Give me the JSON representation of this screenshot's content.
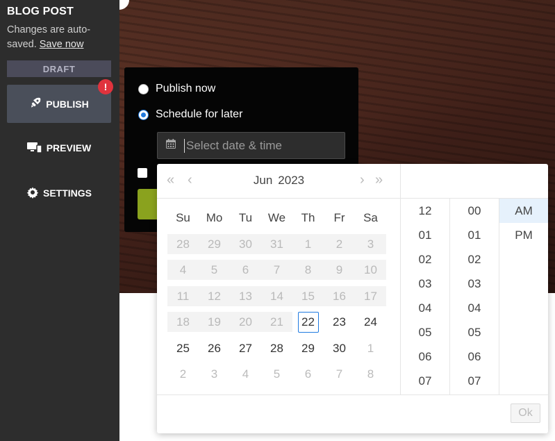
{
  "sidebar": {
    "title": "BLOG POST",
    "note": "Changes are auto-saved.",
    "save_link": "Save now",
    "status": "DRAFT",
    "alert": "!",
    "publish": "PUBLISH",
    "preview": "PREVIEW",
    "settings": "SETTINGS"
  },
  "popover": {
    "publish_now": "Publish now",
    "schedule_later": "Schedule for later",
    "date_placeholder": "Select date & time",
    "selected_option": "schedule_later"
  },
  "picker": {
    "month": "Jun",
    "year": "2023",
    "weekdays": [
      "Su",
      "Mo",
      "Tu",
      "We",
      "Th",
      "Fr",
      "Sa"
    ],
    "weeks": [
      [
        "28",
        "29",
        "30",
        "31",
        "1",
        "2",
        "3"
      ],
      [
        "4",
        "5",
        "6",
        "7",
        "8",
        "9",
        "10"
      ],
      [
        "11",
        "12",
        "13",
        "14",
        "15",
        "16",
        "17"
      ],
      [
        "18",
        "19",
        "20",
        "21",
        "22",
        "23",
        "24"
      ],
      [
        "25",
        "26",
        "27",
        "28",
        "29",
        "30",
        "1"
      ],
      [
        "2",
        "3",
        "4",
        "5",
        "6",
        "7",
        "8"
      ]
    ],
    "today": "22",
    "hours": [
      "12",
      "01",
      "02",
      "03",
      "04",
      "05",
      "06",
      "07"
    ],
    "minutes": [
      "00",
      "01",
      "02",
      "03",
      "04",
      "05",
      "06",
      "07"
    ],
    "ampm": [
      "AM",
      "PM"
    ],
    "selected_ampm": "AM",
    "ok": "Ok"
  },
  "colors": {
    "accent": "#1f7ae0",
    "alert": "#e0333d",
    "publish_green": "#8aa21e"
  }
}
